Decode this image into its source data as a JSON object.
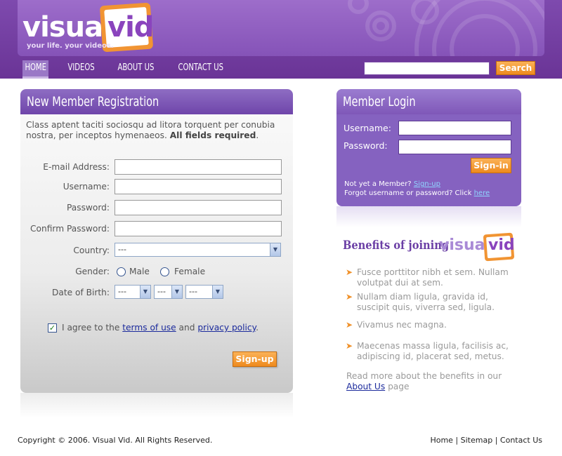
{
  "brand": {
    "name_part1": "visual",
    "name_part2": "vid",
    "tagline": "your life. your videos."
  },
  "nav": {
    "items": [
      {
        "label": "HOME",
        "active": true
      },
      {
        "label": "VIDEOS",
        "active": false
      },
      {
        "label": "ABOUT US",
        "active": false
      },
      {
        "label": "CONTACT US",
        "active": false
      }
    ],
    "search_value": "",
    "search_button": "Search"
  },
  "registration": {
    "title": "New Member Registration",
    "intro": "Class aptent taciti sociosqu ad litora torquent per conubia nostra, per inceptos hymenaeos.",
    "intro_bold": "All fields required",
    "intro_end": ".",
    "fields": {
      "email_label": "E-mail Address:",
      "username_label": "Username:",
      "password_label": "Password:",
      "confirm_label": "Confirm Password:",
      "country_label": "Country:",
      "country_value": "---",
      "gender_label": "Gender:",
      "gender_male": "Male",
      "gender_female": "Female",
      "dob_label": "Date of Birth:",
      "dob_month": "---",
      "dob_day": "---",
      "dob_year": "---"
    },
    "agree_prefix": "I agree to the",
    "agree_terms": "terms of use",
    "agree_and": "and",
    "agree_privacy": "privacy policy",
    "agree_end": ".",
    "agree_checked": true,
    "submit": "Sign-up"
  },
  "login": {
    "title": "Member Login",
    "username_label": "Username:",
    "password_label": "Password:",
    "submit": "Sign-in",
    "not_member": "Not yet a Member?",
    "signup_link": "Sign-up",
    "forgot": "Forgot username or password? Click",
    "here_link": "here"
  },
  "benefits": {
    "title": "Benefits of joining",
    "items": [
      "Fusce porttitor nibh et sem. Nullam volutpat dui at sem.",
      "Nullam diam ligula, gravida id, suscipit quis, viverra sed, ligula.",
      "Vivamus nec magna.",
      "Maecenas massa ligula, facilisis ac, adipiscing id, placerat sed, metus."
    ],
    "read_more_prefix": "Read more about the benefits in our",
    "read_more_link": "About Us",
    "read_more_suffix": "page"
  },
  "footer": {
    "copyright": "Copyright © 2006. Visual Vid. All Rights Reserved.",
    "links": [
      "Home",
      "Sitemap",
      "Contact Us"
    ],
    "separator": "|"
  },
  "colors": {
    "brand_purple": "#8553b8",
    "accent_orange": "#f19433",
    "link_blue": "#1b2a9c"
  }
}
